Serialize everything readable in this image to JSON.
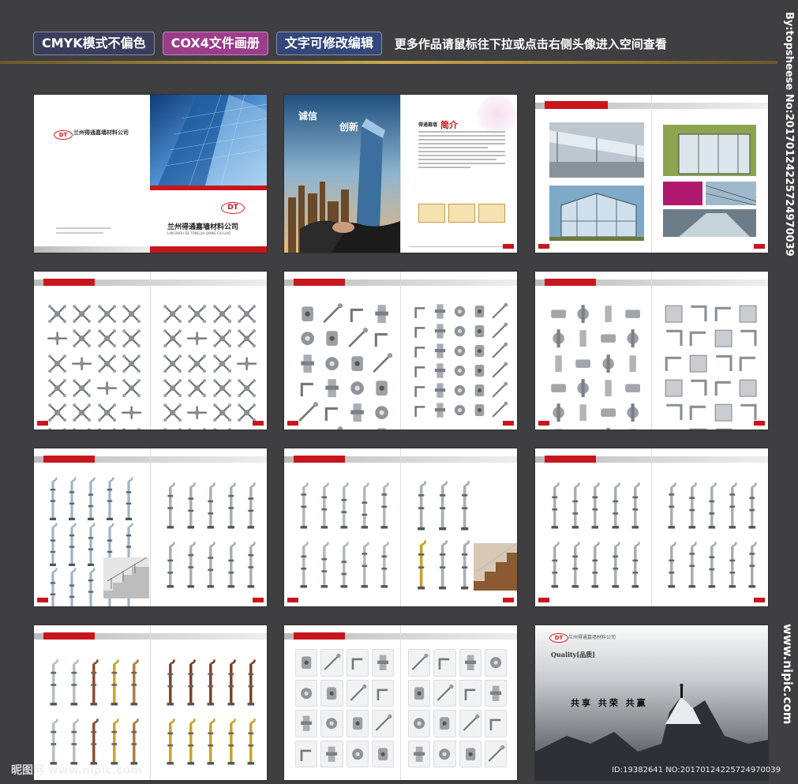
{
  "header": {
    "tag1": "CMYK模式不偏色",
    "tag2": "COX4文件画册",
    "tag3": "文字可修改编辑",
    "note": "更多作品请鼠标往下拉或点击右侧头像进入空间查看"
  },
  "side_text": "By:topsheese No:20170124225724970039",
  "side_site": "www.nipic.com",
  "watermark": "昵图网 www.nipic.com",
  "id_line": "ID:19382641 NO:20170124225724970039",
  "colors": {
    "brand_red": "#c8161d",
    "background": "#3f3f41",
    "tag_purple": "#9b3e8a"
  },
  "cover": {
    "company": "兰州得通嘉墙材料公司",
    "company_pinyin": "LAN ZHOU DE TONG JIA QIANG CAI LIAO",
    "logo": "DT"
  },
  "intro": {
    "slogan_1": "诚信",
    "slogan_2": "创新",
    "title": "简介",
    "brand": "得通幕墙"
  },
  "closing": {
    "quality_label": "Quality[品质]",
    "slogan": "共享 共荣 共赢"
  }
}
